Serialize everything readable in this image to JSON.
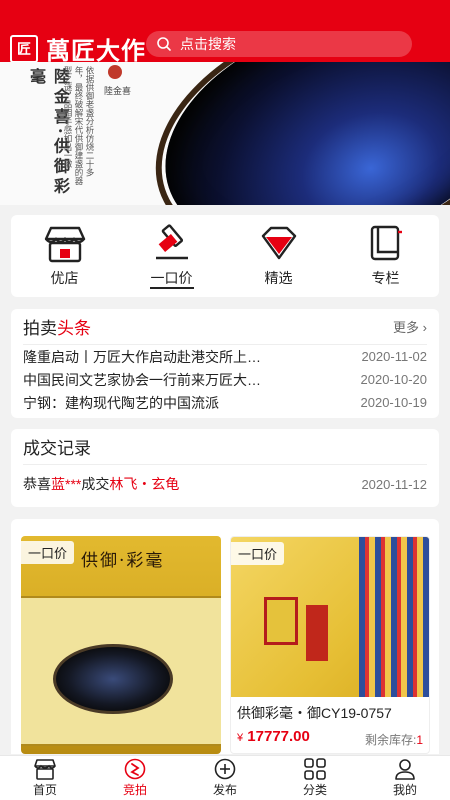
{
  "header": {
    "logo_glyph": "匠",
    "brand": "萬匠大作",
    "search_placeholder": "点击搜索"
  },
  "banner": {
    "title": "陸金喜·供御彩毫",
    "poem": "依据供御老盏分析仿烧二十多年，最终破解宋代供御建盏的器型之谜，品相手感如出一辙",
    "signature": "陸金喜"
  },
  "nav": [
    {
      "label": "优店",
      "icon": "shop-icon"
    },
    {
      "label": "一口价",
      "icon": "gavel-icon"
    },
    {
      "label": "精选",
      "icon": "diamond-icon"
    },
    {
      "label": "专栏",
      "icon": "book-icon"
    }
  ],
  "news": {
    "title_prefix": "拍卖",
    "title_highlight": "头条",
    "more": "更多",
    "items": [
      {
        "text": "隆重启动丨万匠大作启动赴港交所上…",
        "date": "2020-11-02"
      },
      {
        "text": "中国民间文艺家协会一行前来万匠大…",
        "date": "2020-10-20"
      },
      {
        "text": "宁钢：建构现代陶艺的中国流派",
        "date": "2020-10-19"
      }
    ]
  },
  "deal": {
    "title": "成交记录",
    "prefix": "恭喜",
    "buyer": "蓝***",
    "middle": "成交",
    "item": "林飞・玄龟",
    "date": "2020-11-12"
  },
  "goods": [
    {
      "tag": "一口价",
      "image_text": "供御·彩毫"
    },
    {
      "tag": "一口价",
      "name": "供御彩毫・御CY19-0757",
      "currency": "¥",
      "price": "17777.00",
      "stock_label": "剩余库存:",
      "stock": "1"
    }
  ],
  "tabbar": [
    {
      "label": "首页",
      "icon": "home-icon"
    },
    {
      "label": "竞拍",
      "icon": "auction-icon",
      "active": true
    },
    {
      "label": "发布",
      "icon": "plus-circle-icon"
    },
    {
      "label": "分类",
      "icon": "grid-icon"
    },
    {
      "label": "我的",
      "icon": "user-icon"
    }
  ],
  "colors": {
    "brand": "#e60012",
    "text": "#222222",
    "muted": "#777777"
  }
}
